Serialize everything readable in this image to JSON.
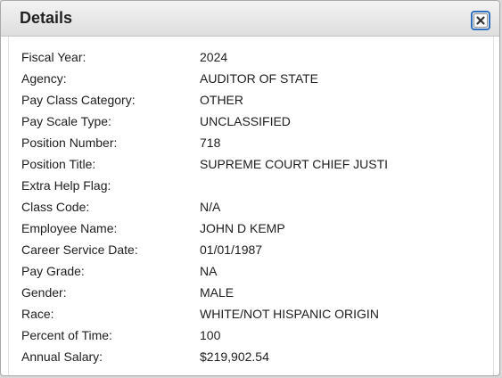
{
  "dialog": {
    "title": "Details",
    "close_label": "close-icon"
  },
  "fields": [
    {
      "label": "Fiscal Year:",
      "value": "2024"
    },
    {
      "label": "Agency:",
      "value": "AUDITOR OF STATE"
    },
    {
      "label": "Pay Class Category:",
      "value": "OTHER"
    },
    {
      "label": "Pay Scale Type:",
      "value": "UNCLASSIFIED"
    },
    {
      "label": "Position Number:",
      "value": "718"
    },
    {
      "label": "Position Title:",
      "value": "SUPREME COURT CHIEF JUSTI"
    },
    {
      "label": "Extra Help Flag:",
      "value": ""
    },
    {
      "label": "Class Code:",
      "value": "N/A"
    },
    {
      "label": "Employee Name:",
      "value": "JOHN D KEMP"
    },
    {
      "label": "Career Service Date:",
      "value": "01/01/1987"
    },
    {
      "label": "Pay Grade:",
      "value": "NA"
    },
    {
      "label": "Gender:",
      "value": "MALE"
    },
    {
      "label": "Race:",
      "value": "WHITE/NOT HISPANIC ORIGIN"
    },
    {
      "label": "Percent of Time:",
      "value": "100"
    },
    {
      "label": "Annual Salary:",
      "value": "$219,902.54"
    }
  ]
}
